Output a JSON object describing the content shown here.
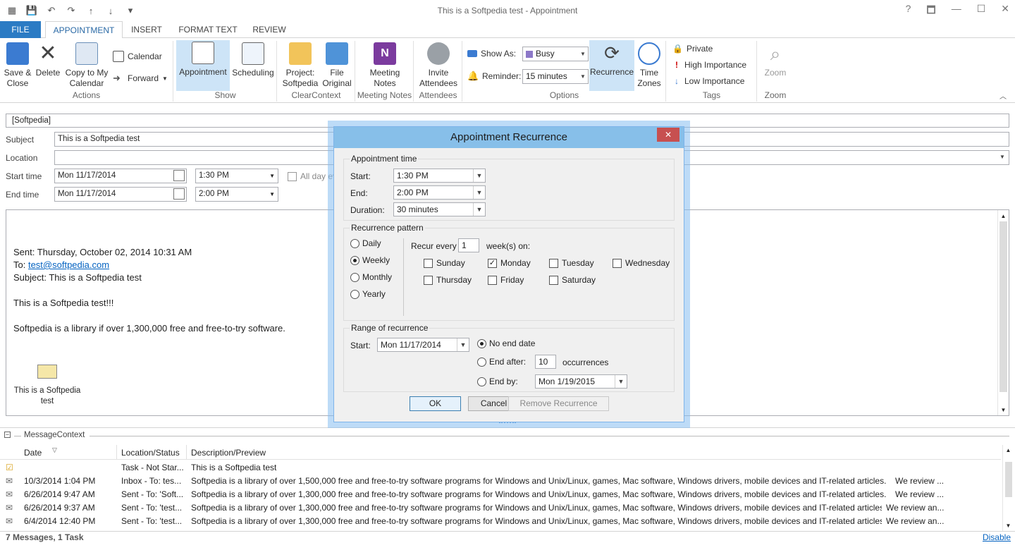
{
  "window": {
    "title": "This is a Softpedia test - Appointment",
    "help": "?",
    "restore": "🗖",
    "minimize": "—",
    "maximize": "☐",
    "close": "✕"
  },
  "tabs": [
    "FILE",
    "APPOINTMENT",
    "INSERT",
    "FORMAT TEXT",
    "REVIEW"
  ],
  "ribbon": {
    "actions": {
      "save_close": [
        "Save &",
        "Close"
      ],
      "delete": "Delete",
      "copy_calendar": [
        "Copy to My",
        "Calendar"
      ],
      "calendar": "Calendar",
      "forward": "Forward",
      "label": "Actions"
    },
    "show": {
      "appointment": "Appointment",
      "scheduling": "Scheduling",
      "label": "Show"
    },
    "clearcontext": {
      "project": [
        "Project:",
        "Softpedia"
      ],
      "file": [
        "File",
        "Original"
      ],
      "label": "ClearContext"
    },
    "meeting_notes": {
      "btn": [
        "Meeting",
        "Notes"
      ],
      "label": "Meeting Notes"
    },
    "attendees": {
      "btn": [
        "Invite",
        "Attendees"
      ],
      "label": "Attendees"
    },
    "options": {
      "show_as": "Show As:",
      "show_as_value": "Busy",
      "reminder": "Reminder:",
      "reminder_value": "15 minutes",
      "recurrence": "Recurrence",
      "time_zones": [
        "Time",
        "Zones"
      ],
      "label": "Options"
    },
    "tags": {
      "private": "Private",
      "high": "High Importance",
      "low": "Low Importance",
      "label": "Tags"
    },
    "zoom": {
      "btn": "Zoom",
      "label": "Zoom"
    }
  },
  "form": {
    "category": "[Softpedia]",
    "subject_label": "Subject",
    "subject": "This is a Softpedia test",
    "location_label": "Location",
    "location": "",
    "start_label": "Start time",
    "start_date": "Mon 11/17/2014",
    "start_time": "1:30 PM",
    "all_day": "All day ev",
    "end_label": "End time",
    "end_date": "Mon 11/17/2014",
    "end_time": "2:00 PM"
  },
  "body": {
    "sent": "Sent: Thursday, October 02, 2014 10:31 AM",
    "to_label": "To: ",
    "to": "test@softpedia.com",
    "subject": "Subject: This is a Softpedia test",
    "line1": "This is a Softpedia test!!!",
    "line2": "Softpedia is a library if over 1,300,000  free and free-to-try software.",
    "attachment": "This is a Softpedia test"
  },
  "dialog": {
    "title": "Appointment Recurrence",
    "appt_time": "Appointment time",
    "start_label": "Start:",
    "start": "1:30 PM",
    "end_label": "End:",
    "end": "2:00 PM",
    "duration_label": "Duration:",
    "duration": "30 minutes",
    "pattern": "Recurrence pattern",
    "daily": "Daily",
    "weekly": "Weekly",
    "monthly": "Monthly",
    "yearly": "Yearly",
    "recur_every": "Recur every",
    "recur_value": "1",
    "weeks_on": "week(s) on:",
    "days": {
      "sunday": "Sunday",
      "monday": "Monday",
      "tuesday": "Tuesday",
      "wednesday": "Wednesday",
      "thursday": "Thursday",
      "friday": "Friday",
      "saturday": "Saturday"
    },
    "range": "Range of recurrence",
    "range_start_label": "Start:",
    "range_start": "Mon 11/17/2014",
    "no_end": "No end date",
    "end_after": "End after:",
    "end_after_value": "10",
    "occurrences": "occurrences",
    "end_by": "End by:",
    "end_by_value": "Mon 1/19/2015",
    "ok": "OK",
    "cancel": "Cancel",
    "remove": "Remove Recurrence"
  },
  "message_context": {
    "title": "MessageContext",
    "headers": {
      "date": "Date",
      "location": "Location/Status",
      "desc": "Description/Preview"
    },
    "rows": [
      {
        "date": "",
        "location": "Task - Not Star...",
        "desc": "This is a Softpedia test",
        "tail": ""
      },
      {
        "date": "10/3/2014 1:04 PM",
        "location": "Inbox - To: tes...",
        "desc": "Softpedia is a library of over 1,500,000 free and free-to-try software programs for Windows and Unix/Linux, games,      Mac software, Windows drivers, mobile devices and IT-related articles.",
        "tail": "We review ..."
      },
      {
        "date": "6/26/2014 9:47 AM",
        "location": "Sent - To: 'Soft...",
        "desc": "Softpedia is a library of over 1,300,000 free and free-to-try software programs for Windows and Unix/Linux, games, Mac software, Windows drivers, mobile devices and IT-related articles.",
        "tail": "We review ..."
      },
      {
        "date": "6/26/2014 9:37 AM",
        "location": "Sent - To: 'test...",
        "desc": "Softpedia is a library of over 1,300,000 free and free-to-try software programs for Windows and Unix/Linux, games, Mac software, Windows drivers, mobile devices and IT-related articles.",
        "tail": "We review an..."
      },
      {
        "date": "6/4/2014 12:40 PM",
        "location": "Sent - To: 'test...",
        "desc": "Softpedia is a library of over 1,300,000 free and free-to-try software programs for Windows and Unix/Linux, games, Mac software, Windows drivers, mobile devices and IT-related articles.",
        "tail": "We review an..."
      }
    ],
    "footer": "7 Messages, 1 Task",
    "disable": "Disable"
  },
  "colors": {
    "accent": "#2b7bc4",
    "selected": "#cde4f7",
    "dialog_title": "#87bfe9",
    "close": "#c75050"
  }
}
